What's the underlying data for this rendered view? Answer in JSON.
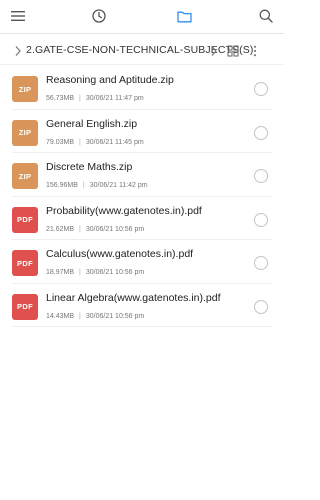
{
  "toolbar": {
    "icons": [
      "menu-icon",
      "recent-icon",
      "folder-icon",
      "search-icon"
    ],
    "accent_color": "#2f8ff0"
  },
  "path": {
    "label": "2.GATE-CSE-NON-TECHNICAL-SUBJECTS(S)"
  },
  "colors": {
    "zip_badge": "#d9955a",
    "pdf_badge": "#e0504e"
  },
  "files": [
    {
      "type": "ZIP",
      "name": "Reasoning and Aptitude.zip",
      "size": "56.73MB",
      "date": "30/06/21 11:47 pm"
    },
    {
      "type": "ZIP",
      "name": "General English.zip",
      "size": "79.03MB",
      "date": "30/06/21 11:45 pm"
    },
    {
      "type": "ZIP",
      "name": "Discrete Maths.zip",
      "size": "156.96MB",
      "date": "30/06/21 11:42 pm"
    },
    {
      "type": "PDF",
      "name": "Probability(www.gatenotes.in).pdf",
      "size": "21.62MB",
      "date": "30/06/21 10:56 pm"
    },
    {
      "type": "PDF",
      "name": "Calculus(www.gatenotes.in).pdf",
      "size": "18.97MB",
      "date": "30/06/21 10:56 pm"
    },
    {
      "type": "PDF",
      "name": "Linear Algebra(www.gatenotes.in).pdf",
      "size": "14.43MB",
      "date": "30/06/21 10:56 pm"
    }
  ]
}
